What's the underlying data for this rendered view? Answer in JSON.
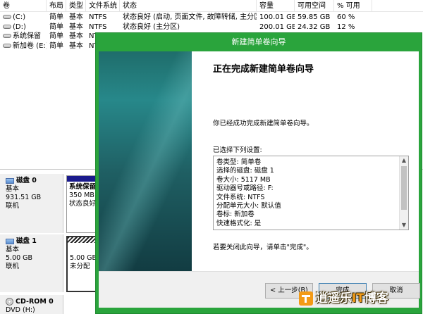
{
  "columns": [
    "卷",
    "布局",
    "类型",
    "文件系统",
    "状态",
    "容量",
    "可用空间",
    "% 可用"
  ],
  "volumes": [
    {
      "name": "(C:)",
      "layout": "简单",
      "type": "基本",
      "fs": "NTFS",
      "status": "状态良好 (启动, 页面文件, 故障转储, 主分区)",
      "capacity": "100.01 GB",
      "free": "59.85 GB",
      "pct": "60 %"
    },
    {
      "name": "(D:)",
      "layout": "简单",
      "type": "基本",
      "fs": "NTFS",
      "status": "状态良好 (主分区)",
      "capacity": "200.01 GB",
      "free": "24.32 GB",
      "pct": "12 %"
    },
    {
      "name": "系统保留",
      "layout": "简单",
      "type": "基本",
      "fs": "NT",
      "status": "",
      "capacity": "",
      "free": "",
      "pct": ""
    },
    {
      "name": "新加卷 (E:)",
      "layout": "简单",
      "type": "基本",
      "fs": "NT",
      "status": "",
      "capacity": "",
      "free": "",
      "pct": ""
    }
  ],
  "disks": [
    {
      "name": "磁盘 0",
      "type": "基本",
      "size": "931.51 GB",
      "state": "联机"
    },
    {
      "name": "磁盘 1",
      "type": "基本",
      "size": "5.00 GB",
      "state": "联机"
    },
    {
      "name": "CD-ROM 0",
      "type": "DVD (H:)"
    }
  ],
  "partitions": {
    "sysres": {
      "name": "系统保留",
      "size": "350 MB",
      "status": "状态良好"
    },
    "unalloc": {
      "size": "5.00 GB",
      "status": "未分配"
    }
  },
  "wizard": {
    "title": "新建简单卷向导",
    "heading": "正在完成新建简单卷向导",
    "text_completed": "你已经成功完成新建简单卷向导。",
    "text_selected": "已选择下列设置:",
    "settings": [
      "卷类型: 简单卷",
      "选择的磁盘: 磁盘 1",
      "卷大小: 5117 MB",
      "驱动器号或路径: F:",
      "文件系统: NTFS",
      "分配单元大小: 默认值",
      "卷标: 新加卷",
      "快速格式化: 是"
    ],
    "text_close": "若要关闭此向导，请单击\"完成\"。",
    "btn_back": "< 上一步(B)",
    "btn_finish": "完成",
    "btn_cancel": "取消"
  },
  "watermark": {
    "prefix": "逍遥乐",
    "it": "IT",
    "suffix": "博客"
  },
  "colors": {
    "dialog_frame": "#2aa43c",
    "disk_bar_primary": "#1a1a8c"
  }
}
